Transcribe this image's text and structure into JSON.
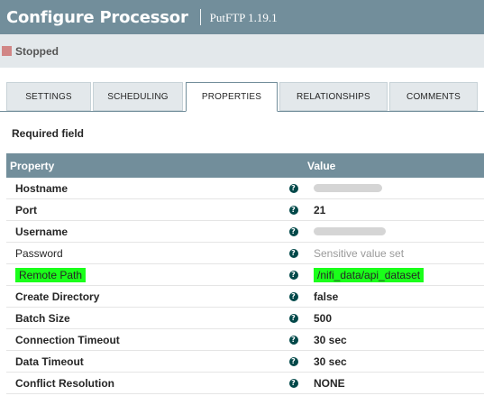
{
  "header": {
    "title": "Configure Processor",
    "version": "PutFTP 1.19.1"
  },
  "status": {
    "label": "Stopped",
    "color": "#d18686"
  },
  "tabs": [
    {
      "label": "SETTINGS",
      "active": false
    },
    {
      "label": "SCHEDULING",
      "active": false
    },
    {
      "label": "PROPERTIES",
      "active": true
    },
    {
      "label": "RELATIONSHIPS",
      "active": false
    },
    {
      "label": "COMMENTS",
      "active": false
    }
  ],
  "required_label": "Required field",
  "table": {
    "columns": [
      "Property",
      "Value"
    ],
    "rows": [
      {
        "name": "Hostname",
        "value": ""
      },
      {
        "name": "Port",
        "value": "21"
      },
      {
        "name": "Username",
        "value": ""
      },
      {
        "name": "Password",
        "value": "Sensitive value set"
      },
      {
        "name": "Remote Path",
        "value": "/nifi_data/api_dataset"
      },
      {
        "name": "Create Directory",
        "value": "false"
      },
      {
        "name": "Batch Size",
        "value": "500"
      },
      {
        "name": "Connection Timeout",
        "value": "30 sec"
      },
      {
        "name": "Data Timeout",
        "value": "30 sec"
      },
      {
        "name": "Conflict Resolution",
        "value": "NONE"
      }
    ]
  },
  "icons": {
    "help": "help-icon",
    "status": "stopped-icon"
  },
  "colors": {
    "header": "#728e9b",
    "highlight": "#1aff1a",
    "help": "#004849"
  }
}
